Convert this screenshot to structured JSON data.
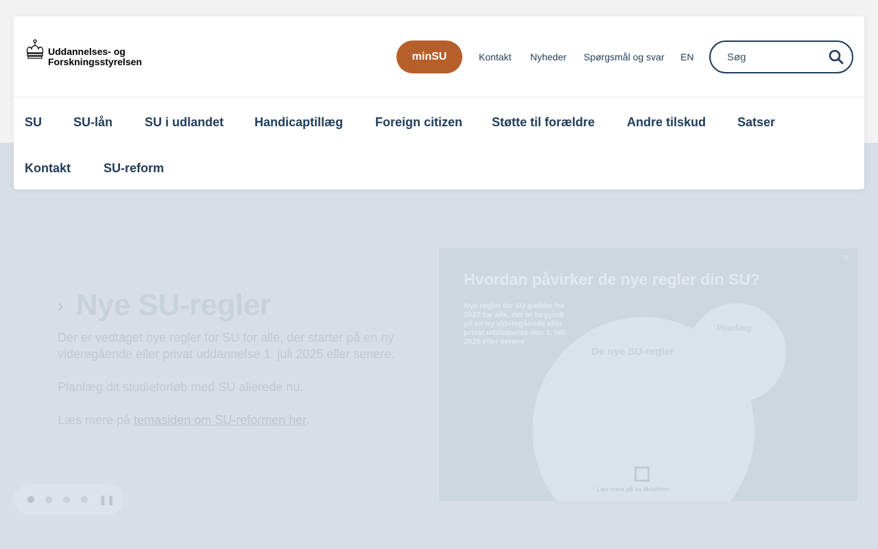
{
  "header": {
    "logo_line1": "Uddannelses- og",
    "logo_line2": "Forskningsstyrelsen",
    "minsu_label": "minSU",
    "top_links": [
      "Kontakt",
      "Nyheder",
      "Spørgsmål og svar",
      "EN"
    ],
    "search": {
      "placeholder": "Søg"
    }
  },
  "nav": {
    "row1": [
      "SU",
      "SU-lån",
      "SU i udlandet",
      "Handicaptillæg",
      "Foreign citizen",
      "Støtte til forældre",
      "Andre tilskud",
      "Satser"
    ],
    "row2": [
      "Kontakt",
      "SU-reform"
    ]
  },
  "hero": {
    "title": "Nye SU-regler",
    "paragraph1": "Der er vedtaget nye regler for SU for alle, der starter på en ny videregående eller privat uddannelse 1. juli 2025 eller senere.",
    "paragraph2": "Planlæg dit studieforløb med SU allerede nu.",
    "paragraph3_prefix": "Læs mere på ",
    "paragraph3_link": "temasiden om SU-reformen her",
    "paragraph3_suffix": ".",
    "image": {
      "title": "Hvordan påvirker de nye regler din SU?",
      "intro": "Nye regler for SU gælder fra 2027 for alle, der er begyndt på en ny videregående eller privat uddannelse den 1. juli 2025 eller senere",
      "bubble_title": "De nye SU-regler",
      "plan_title": "Planlæg",
      "more": "Læs mere på su.dk/reform"
    }
  },
  "carousel": {
    "slides": 4,
    "active": 1
  },
  "colors": {
    "primary": "#1f3b58",
    "accent": "#b75f2b",
    "hero_bg": "#d8dee6"
  }
}
